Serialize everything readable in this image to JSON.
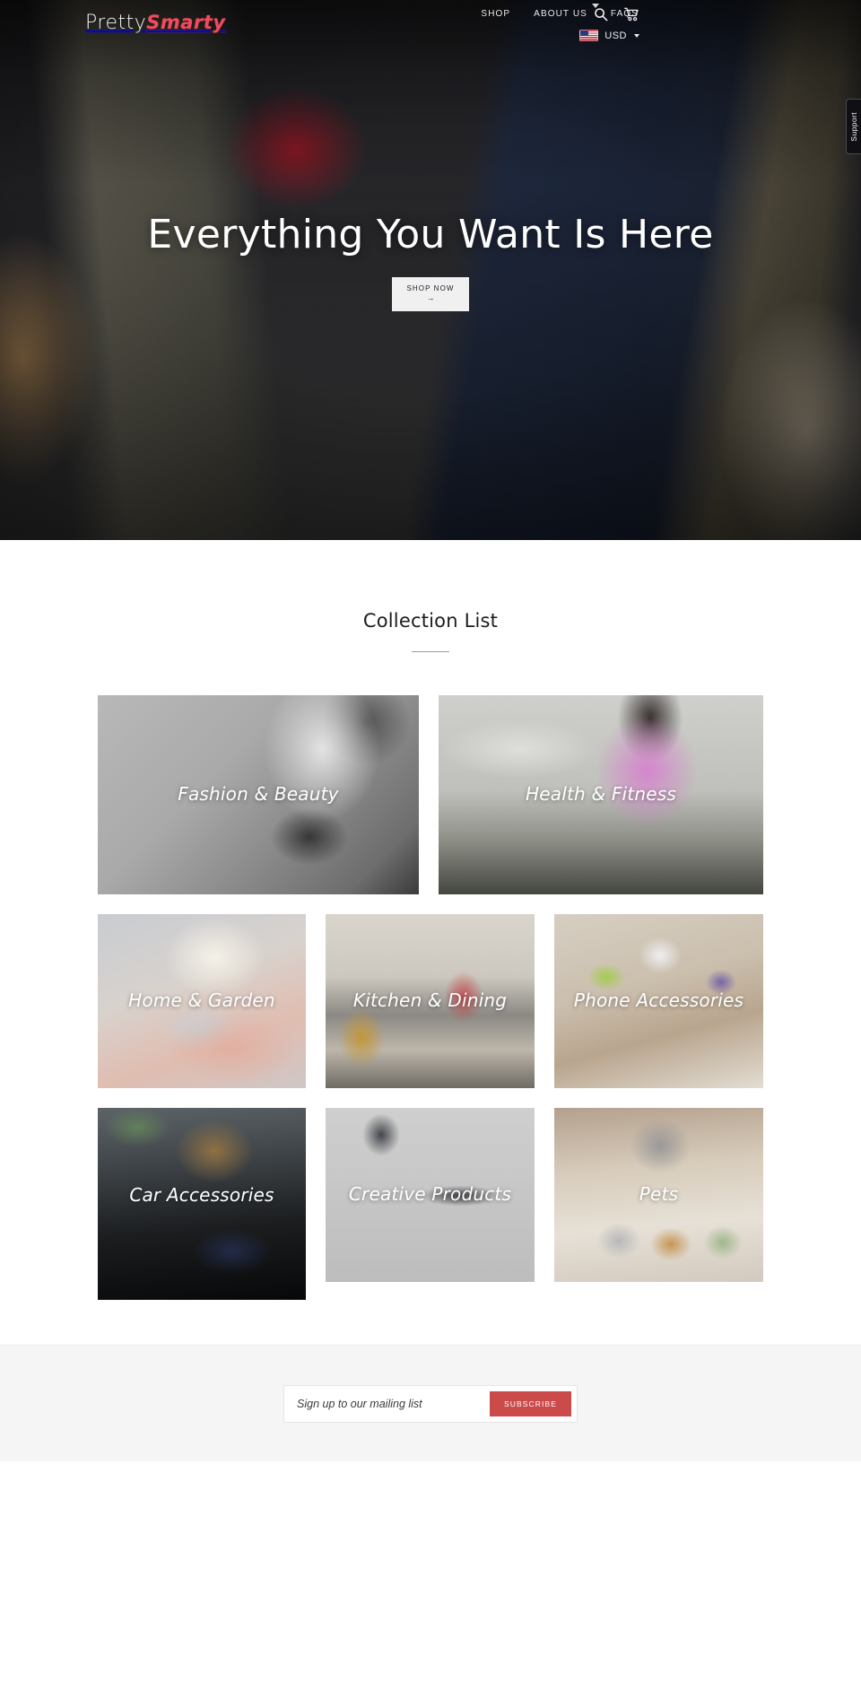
{
  "header": {
    "logo": {
      "part1": "Pretty",
      "part2": "Smarty"
    },
    "nav": [
      {
        "label": "SHOP",
        "name": "nav-shop"
      },
      {
        "label": "ABOUT US",
        "name": "nav-about-us"
      },
      {
        "label": "FAQS",
        "name": "nav-faqs"
      }
    ],
    "icons": [
      {
        "name": "search-icon",
        "semantic": "search-icon"
      },
      {
        "name": "cart-icon",
        "semantic": "shopping-cart-icon"
      }
    ],
    "currency": {
      "code": "USD",
      "flag": "us-flag-icon"
    }
  },
  "support_tab": {
    "label": "Support"
  },
  "hero": {
    "title": "Everything You Want Is Here",
    "cta_label": "SHOP NOW",
    "cta_arrow": "→"
  },
  "collections": {
    "title": "Collection List",
    "rows": [
      [
        {
          "label": "Fashion & Beauty",
          "name": "collection-tile-fashion-beauty"
        },
        {
          "label": "Health & Fitness",
          "name": "collection-tile-health-fitness"
        }
      ],
      [
        {
          "label": "Home & Garden",
          "name": "collection-tile-home-garden"
        },
        {
          "label": "Kitchen & Dining",
          "name": "collection-tile-kitchen-dining"
        },
        {
          "label": "Phone Accessories",
          "name": "collection-tile-phone-accessories"
        }
      ],
      [
        {
          "label": "Car Accessories",
          "name": "collection-tile-car-accessories"
        },
        {
          "label": "Creative Products",
          "name": "collection-tile-creative-products"
        },
        {
          "label": "Pets",
          "name": "collection-tile-pets"
        }
      ]
    ]
  },
  "newsletter": {
    "placeholder": "Sign up to our mailing list",
    "value": "",
    "button_label": "SUBSCRIBE"
  },
  "colors": {
    "accent_pink": "#f04a5e",
    "subscribe_red": "#cb4b4b",
    "newsletter_bg": "#f5f5f5",
    "cta_bg": "#f0f0f0"
  }
}
